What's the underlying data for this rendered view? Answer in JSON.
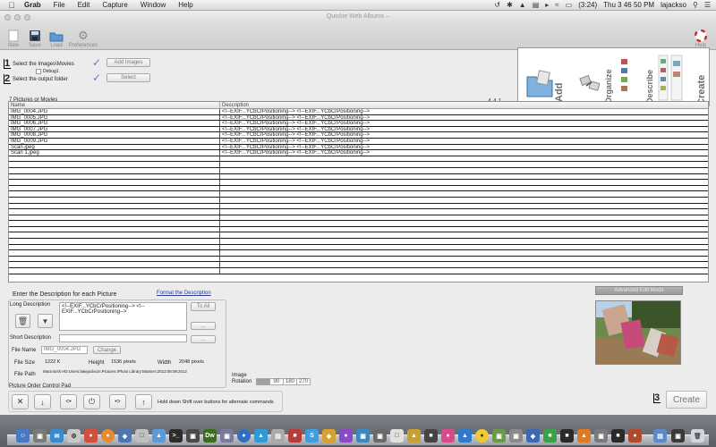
{
  "menubar": {
    "app_name": "Grab",
    "items": [
      "File",
      "Edit",
      "Capture",
      "Window",
      "Help"
    ],
    "battery": "(3:24)",
    "clock": "Thu 3 46 50 PM",
    "user": "lajackso"
  },
  "window": {
    "title": "Quickie Web Albums –"
  },
  "toolbar": {
    "new_label": "New",
    "save_label": "Save",
    "load_label": "Load",
    "preferences_label": "Preferences",
    "help_label": "Help"
  },
  "steps": {
    "step1_num": "1",
    "step1_label": "Select the Images\\Movies",
    "step1_button": "Add Images",
    "debug_label": "Debug1",
    "step2_num": "2",
    "step2_label": "Select the output folder",
    "step2_button": "Select",
    "step3_num": "3",
    "create_button": "Create"
  },
  "logo_panel": {
    "words": [
      "Add",
      "Organize",
      "Describe",
      "Create"
    ]
  },
  "summary": {
    "count_label": "7 Pictures or Movies",
    "version": "4.4.1"
  },
  "table": {
    "headers": [
      "Name",
      "Description"
    ],
    "rows": [
      {
        "name": "IMG_0004.JPG",
        "desc": "<!--EXIF...YCbCrPositioning--> <!--EXIF...YCbCrPositioning-->"
      },
      {
        "name": "IMG_0005.JPG",
        "desc": "<!--EXIF...YCbCrPositioning--> <!--EXIF...YCbCrPositioning-->"
      },
      {
        "name": "IMG_0006.JPG",
        "desc": "<!--EXIF...YCbCrPositioning--> <!--EXIF...YCbCrPositioning-->"
      },
      {
        "name": "IMG_0007.JPG",
        "desc": "<!--EXIF...YCbCrPositioning--> <!--EXIF...YCbCrPositioning-->"
      },
      {
        "name": "IMG_0008.JPG",
        "desc": "<!--EXIF...YCbCrPositioning--> <!--EXIF...YCbCrPositioning-->"
      },
      {
        "name": "IMG_0009.JPG",
        "desc": "<!--EXIF...YCbCrPositioning--> <!--EXIF...YCbCrPositioning-->"
      },
      {
        "name": "Scan.jpeg",
        "desc": "<!--EXIF...YCbCrPositioning--> <!--EXIF...YCbCrPositioning-->"
      },
      {
        "name": "Scan 1.jpeg",
        "desc": "<!--EXIF...YCbCrPositioning--> <!--EXIF...YCbCrPositioning-->"
      }
    ],
    "empty_rows": 20
  },
  "description": {
    "section_title": "Enter  the Description for each Picture",
    "format_link": "Format the Description",
    "long_label": "Long Description",
    "long_value": "<!--EXIF...YCbCrPositioning--> <!--EXIF...YCbCrPositioning-->",
    "to_all": "To All",
    "short_label": "Short Description",
    "short_value": "",
    "more_button": "...",
    "file_name_label": "File Name",
    "file_name_value": "IMG_0004.JPG",
    "change_button": "Change",
    "file_size_label": "File Size",
    "file_size_value": "1222 K",
    "height_label": "Height",
    "height_value": "1536 pixels",
    "width_label": "Width",
    "width_value": "2048 pixels",
    "file_path_label": "File Path",
    "file_path_value": "Macintosh HD:Users:lakejackson:Pictures:iPhoto Library:Masters:2012:05:09:2012",
    "rotation_label": "Image Rotation",
    "rotation_options": [
      "0",
      "90",
      "180",
      "270"
    ],
    "rotation_selected": "0"
  },
  "pad": {
    "title": "Picture Order Control Pad",
    "hint": "Hold down Shift over buttons for alternate commands"
  },
  "advanced_button": "Advanced Edit Mode",
  "colors": {
    "check": "#5b7fc7",
    "link": "#2d3b9c"
  }
}
